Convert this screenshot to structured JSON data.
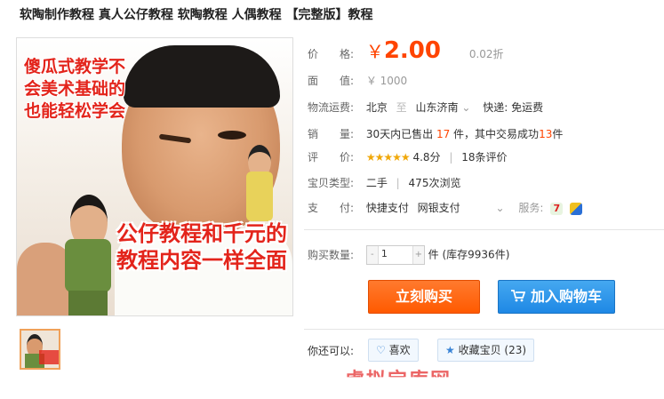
{
  "product": {
    "title": "软陶制作教程 真人公仔教程 软陶教程 人偶教程 【完整版】教程",
    "image_text_top": "傻瓜式教学不会美术基础的也能轻松学会",
    "image_text_bottom": "公仔教程和千元的教程内容一样全面"
  },
  "info": {
    "price_label": "价　　格:",
    "price_symbol": "￥",
    "price_value": "2.00",
    "discount": "0.02折",
    "face_label": "面　　值:",
    "face_value": "￥ 1000",
    "shipping_label": "物流运费:",
    "shipping_from": "北京",
    "shipping_sep": "至",
    "shipping_to": "山东济南",
    "shipping_mode": "快递: 免运费",
    "sales_label": "销　　量:",
    "sales_prefix": "30天内已售出",
    "sales_count": "17",
    "sales_mid": "件，其中交易成功",
    "sales_success": "13",
    "sales_suffix": "件",
    "rating_label": "评　　价:",
    "rating_stars": "★★★★★",
    "rating_score": "4.8分",
    "rating_reviews": "18条评价",
    "type_label": "宝贝类型:",
    "type_value": "二手",
    "views": "475次浏览",
    "pay_label": "支　　付:",
    "pay_quick": "快捷支付",
    "pay_bank": "网银支付",
    "service_label": "服务:",
    "qty_label": "购买数量:",
    "qty_minus": "-",
    "qty_value": "1",
    "qty_plus": "+",
    "stock": "件 (库存9936件)",
    "buy_now": "立刻购买",
    "add_cart": "加入购物车",
    "also_label": "你还可以:",
    "like_btn": "喜欢",
    "fav_btn": "收藏宝贝 (23)",
    "watermark": "虚拟宝库网"
  },
  "colors": {
    "accent": "#ff4400",
    "stars": "#f0a80a",
    "buy_button": "#ff5a00",
    "cart_button": "#1e88e5"
  }
}
